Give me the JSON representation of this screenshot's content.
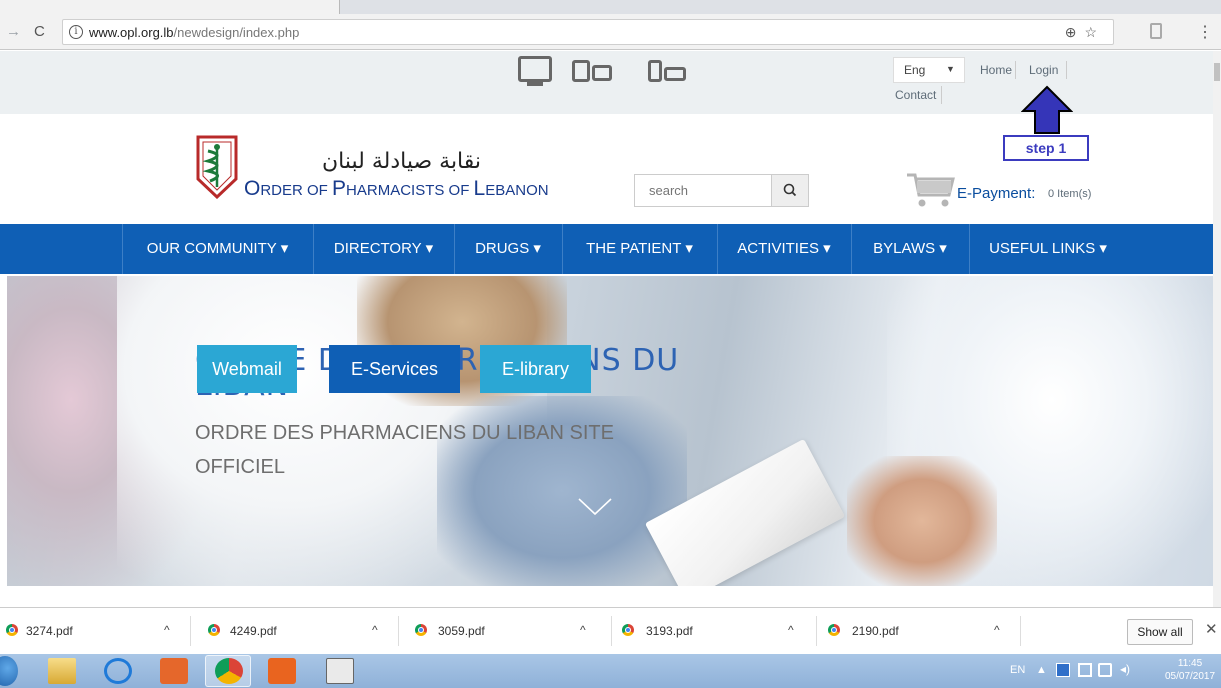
{
  "browser": {
    "url_host": "www.opl.org.lb",
    "url_path": "/newdesign/index.php",
    "info_glyph": "i",
    "nav_icons": [
      "back-arrow-icon",
      "reload-icon"
    ],
    "omnibox_icons": [
      "zoom-icon",
      "star-icon",
      "extension-icon"
    ]
  },
  "top": {
    "language": "Eng",
    "language_caret": "▼",
    "links": {
      "home": "Home",
      "login": "Login",
      "contact": "Contact"
    },
    "device_icons": [
      "desktop-icon",
      "tablet-icon",
      "mobile-icon"
    ]
  },
  "header": {
    "logo_arabic": "نقابة صيادلة لبنان",
    "logo_english": {
      "o": "O",
      "rder": "RDER OF ",
      "p": "P",
      "harmacists": "HARMACISTS OF ",
      "l": "L",
      "ebanon": "EBANON"
    },
    "search_placeholder": "search",
    "epayment_label": "E-Payment:",
    "cart_items": "0 Item(s)"
  },
  "annotation": {
    "step": "step 1",
    "arrow_color": "#3535b8"
  },
  "nav": {
    "items": [
      {
        "label": "OUR COMMUNITY",
        "caret": "▾"
      },
      {
        "label": "DIRECTORY",
        "caret": "▾"
      },
      {
        "label": "DRUGS",
        "caret": "▾"
      },
      {
        "label": "THE PATIENT",
        "caret": "▾"
      },
      {
        "label": "ACTIVITIES",
        "caret": "▾"
      },
      {
        "label": "BYLAWS",
        "caret": "▾"
      },
      {
        "label": "USEFUL LINKS",
        "caret": "▾"
      }
    ]
  },
  "hero": {
    "title": "ORDRE DES PHARMACIENS DU LIBAN",
    "subtitle": "ORDRE DES PHARMACIENS DU LIBAN SITE OFFICIEL",
    "buttons": [
      {
        "label": "Webmail",
        "color": "#2ba7d4"
      },
      {
        "label": "E-Services",
        "color": "#0f5fb5"
      },
      {
        "label": "E-library",
        "color": "#2ba7d4"
      }
    ]
  },
  "downloads": {
    "files": [
      "3274.pdf",
      "4249.pdf",
      "3059.pdf",
      "3193.pdf",
      "2190.pdf"
    ],
    "caret": "^",
    "show_all": "Show all",
    "close": "✕"
  },
  "taskbar": {
    "lang": "EN",
    "time": "11:45",
    "date": "05/07/2017"
  },
  "colors": {
    "nav_blue": "#0f5fb5",
    "brand_blue": "#183b8c",
    "cyan": "#2ba7d4"
  }
}
